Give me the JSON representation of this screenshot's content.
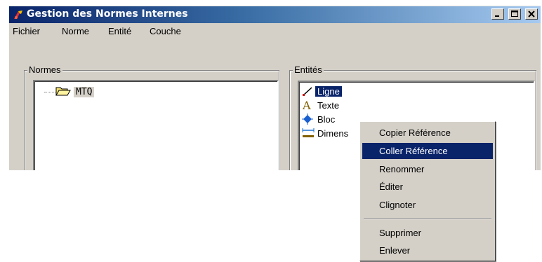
{
  "window": {
    "title": "Gestion des Normes Internes",
    "title_bar_colors": {
      "start": "#0a246a",
      "end": "#a6caf0"
    },
    "controls": [
      "minimize-icon",
      "maximize-icon",
      "close-icon"
    ]
  },
  "menubar": {
    "items": [
      {
        "label": "Fichier"
      },
      {
        "label": "Norme"
      },
      {
        "label": "Entité"
      },
      {
        "label": "Couche"
      }
    ]
  },
  "normes": {
    "legend": "Normes",
    "tree": [
      {
        "label": "MTQ",
        "icon": "open-folder-icon"
      }
    ]
  },
  "entites": {
    "legend": "Entités",
    "items": [
      {
        "label": "Ligne",
        "icon": "line-icon",
        "selected": true
      },
      {
        "label": "Texte",
        "icon": "text-icon",
        "selected": false
      },
      {
        "label": "Bloc",
        "icon": "block-icon",
        "selected": false
      },
      {
        "label": "Dimens",
        "icon": "dimension-icon",
        "selected": false
      }
    ]
  },
  "context_menu": {
    "items": [
      {
        "label": "Copier  Référence"
      },
      {
        "label": "Coller Référence",
        "highlighted": true
      },
      {
        "label": "Renommer"
      },
      {
        "label": "Éditer"
      },
      {
        "label": "Clignoter"
      },
      {
        "label": "Supprimer"
      },
      {
        "label": "Enlever"
      }
    ]
  },
  "colors": {
    "face": "#d4d0c8",
    "selection": "#0a246a"
  }
}
